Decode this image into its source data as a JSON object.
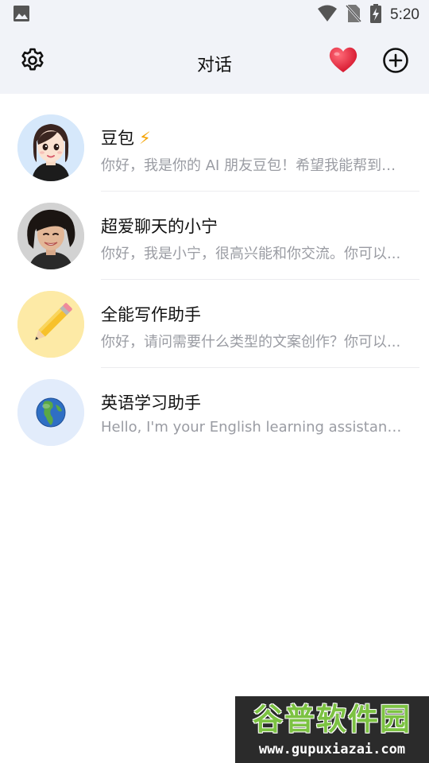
{
  "status_bar": {
    "time": "5:20",
    "icons": [
      "image-icon",
      "wifi-icon",
      "no-sim-icon",
      "battery-charging-icon"
    ]
  },
  "app_bar": {
    "title": "对话",
    "left_icon": "gear-icon",
    "right_icons": [
      "heart-icon",
      "add-circle-icon"
    ]
  },
  "conversations": [
    {
      "name": "豆包",
      "badge": "⚡",
      "preview": "你好，我是你的 AI 朋友豆包！希望我能帮到你...",
      "avatar": "cartoon-girl-avatar",
      "avatar_bg": "#d6e8fb"
    },
    {
      "name": "超爱聊天的小宁",
      "badge": "",
      "preview": "你好，我是小宁，很高兴能和你交流。你可以...",
      "avatar": "photo-girl-avatar",
      "avatar_bg": "#cfcfcf"
    },
    {
      "name": "全能写作助手",
      "badge": "",
      "preview": "你好，请问需要什么类型的文案创作？你可以...",
      "avatar": "pencil-avatar",
      "avatar_bg": "#fdeaa6"
    },
    {
      "name": "英语学习助手",
      "badge": "",
      "preview": "Hello, I'm your English learning assistant. Let's...",
      "avatar": "globe-avatar",
      "avatar_bg": "#e2ecfb"
    }
  ],
  "watermark": {
    "title": "谷普软件园",
    "url": "www.gupuxiazai.com"
  },
  "colors": {
    "header_bg": "#f1f3f8",
    "heart": "#e8263a",
    "badge": "#f5a300",
    "subtitle": "#9a9ca3"
  }
}
